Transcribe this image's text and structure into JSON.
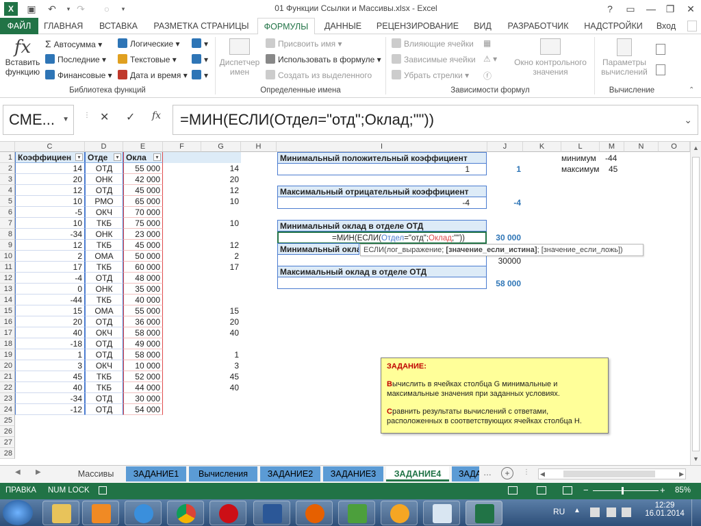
{
  "window": {
    "title": "01 Функции Ссылки и Массивы.xlsx - Excel",
    "help": "?",
    "minimize": "—",
    "restore": "❐",
    "close": "✕"
  },
  "ribbon_tabs": [
    "ФАЙЛ",
    "ГЛАВНАЯ",
    "ВСТАВКА",
    "РАЗМЕТКА СТРАНИЦЫ",
    "ФОРМУЛЫ",
    "ДАННЫЕ",
    "РЕЦЕНЗИРОВАНИЕ",
    "ВИД",
    "РАЗРАБОТЧИК",
    "НАДСТРОЙКИ"
  ],
  "signin": "Вход",
  "ribbon": {
    "insert_fn": [
      "Вставить",
      "функцию"
    ],
    "autosum": "Автосумма",
    "recent": "Последние",
    "financial": "Финансовые",
    "logical": "Логические",
    "text": "Текстовые",
    "datetime": "Дата и время",
    "grp_library": "Библиотека функций",
    "name_mgr": [
      "Диспетчер",
      "имен"
    ],
    "assign_name": "Присвоить имя",
    "use_in_formula": "Использовать в формуле",
    "create_from_sel": "Создать из выделенного",
    "grp_names": "Определенные имена",
    "trace_prec": "Влияющие ячейки",
    "trace_dep": "Зависимые ячейки",
    "remove_arrows": "Убрать стрелки",
    "watch": [
      "Окно контрольного",
      "значения"
    ],
    "grp_audit": "Зависимости формул",
    "calc_options": [
      "Параметры",
      "вычислений"
    ],
    "grp_calc": "Вычисление"
  },
  "formula_bar": {
    "name_box": "СМЕ...",
    "cancel": "✕",
    "enter": "✓",
    "fx": "fx",
    "formula": "=МИН(ЕСЛИ(Отдел=\"отд\";Оклад;\"\"))"
  },
  "columns": [
    "C",
    "D",
    "E",
    "F",
    "G",
    "H",
    "I",
    "J",
    "K",
    "L",
    "M",
    "N",
    "O"
  ],
  "rows": [
    "1",
    "2",
    "3",
    "4",
    "5",
    "6",
    "7",
    "8",
    "9",
    "10",
    "11",
    "12",
    "13",
    "14",
    "15",
    "16",
    "17",
    "18",
    "19",
    "20",
    "21",
    "22",
    "23",
    "24",
    "25",
    "26",
    "27",
    "28"
  ],
  "table": {
    "headers": [
      "Коэффициен",
      "Отде",
      "Окла"
    ],
    "coef": [
      "14",
      "20",
      "12",
      "10",
      "-5",
      "10",
      "-34",
      "12",
      "2",
      "17",
      "-4",
      "0",
      "-44",
      "15",
      "20",
      "40",
      "-18",
      "1",
      "3",
      "45",
      "40",
      "-34",
      "-12"
    ],
    "dept": [
      "ОТД",
      "ОНК",
      "ОТД",
      "РМО",
      "ОКЧ",
      "ТКБ",
      "ОНК",
      "ТКБ",
      "ОМА",
      "ТКБ",
      "ОТД",
      "ОНК",
      "ТКБ",
      "ОМА",
      "ОТД",
      "ОКЧ",
      "ОТД",
      "ОТД",
      "ОКЧ",
      "ТКБ",
      "ТКБ",
      "ОТД",
      "ОТД"
    ],
    "salary": [
      "55 000",
      "42 000",
      "45 000",
      "65 000",
      "70 000",
      "75 000",
      "23 000",
      "45 000",
      "50 000",
      "60 000",
      "48 000",
      "35 000",
      "40 000",
      "55 000",
      "36 000",
      "58 000",
      "49 000",
      "58 000",
      "10 000",
      "52 000",
      "44 000",
      "30 000",
      "54 000"
    ],
    "g": [
      "14",
      "20",
      "12",
      "10",
      "",
      "10",
      "",
      "12",
      "2",
      "17",
      "",
      "",
      "",
      "15",
      "20",
      "40",
      "",
      "1",
      "3",
      "45",
      "40",
      "",
      ""
    ]
  },
  "boxes": {
    "b1_title": "Минимальный положительный коэффициент",
    "b1_val": "1",
    "b1_j": "1",
    "b2_title": "Максимальный отрицательный коэффициент",
    "b2_val": "-4",
    "b2_j": "-4",
    "b3_title": "Минимальный оклад в отделе ОТД",
    "edit_prefix": "=МИН(ЕСЛИ(",
    "edit_ref1": "Отдел",
    "edit_mid": "=\"отд\";",
    "edit_ref2": "Оклад",
    "edit_suffix": ";\"\"))",
    "b3_j": "30 000",
    "b4_title": "Минимальный окла",
    "b4_j": "30000",
    "b5_title": "Максимальный оклад в отделе ОТД",
    "b5_j": "58 000",
    "tooltip_a": "ЕСЛИ(лог_выражение; ",
    "tooltip_b": "[значение_если_истина]",
    "tooltip_c": "; [значение_если_ложь])"
  },
  "minmax": {
    "min_label": "минимум",
    "min_val": "-44",
    "max_label": "максимум",
    "max_val": "45"
  },
  "note": {
    "title": "ЗАДАНИЕ:",
    "p1": "ычислить в ячейках столбца G минимальные и максимальные значения при заданных условиях.",
    "p1_first": "В",
    "p2_first": "С",
    "p2": "равнить результаты вычислений с ответами, расположенных в соответствующих ячейках столбца Н."
  },
  "sheet_tabs": [
    "Массивы",
    "ЗАДАНИЕ1",
    "Вычисления",
    "ЗАДАНИЕ2",
    "ЗАДАНИЕ3",
    "ЗАДАНИЕ4",
    "ЗАДА"
  ],
  "status": {
    "ready": "ПРАВКА",
    "numlock": "NUM LOCK",
    "zoom": "85%"
  },
  "taskbar": {
    "lang": "RU",
    "time": "12:29",
    "date": "16.01.2014"
  },
  "colors": {
    "excel_green": "#217346",
    "table_blue": "#4a7bd0",
    "accent_blue": "#2e75b6"
  }
}
